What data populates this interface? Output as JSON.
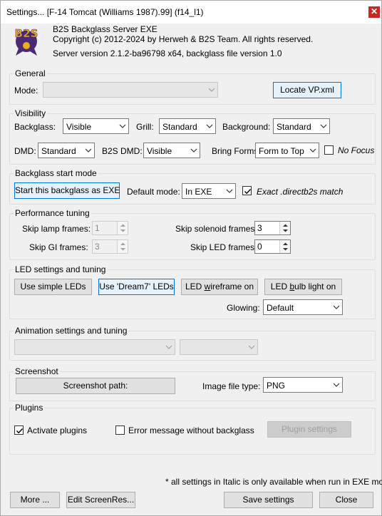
{
  "window": {
    "title": "Settings... [F-14 Tomcat (Williams 1987).99]  (f14_l1)"
  },
  "header": {
    "app_name": "B2S Backglass Server EXE",
    "copyright": "Copyright (c) 2012-2024 by Herweh & B2S Team. All rights reserved.",
    "version": "Server version 2.1.2-ba96798 x64, backglass file version 1.0",
    "logo_text": "B2S"
  },
  "general": {
    "legend": "General",
    "mode_label": "Mode:",
    "mode_value": "",
    "locate_button": "Locate VP.xml"
  },
  "visibility": {
    "legend": "Visibility",
    "backglass_label": "Backglass:",
    "backglass_value": "Visible",
    "grill_label": "Grill:",
    "grill_value": "Standard",
    "background_label": "Background:",
    "background_value": "Standard",
    "dmd_label": "DMD:",
    "dmd_value": "Standard",
    "b2s_dmd_label": "B2S DMD:",
    "b2s_dmd_value": "Visible",
    "bring_forms_label": "Bring Forms",
    "bring_forms_value": "Form to Top",
    "no_focus_label": "No Focus"
  },
  "start_mode": {
    "legend": "Backglass start mode",
    "start_button": "Start this backglass as EXE",
    "default_mode_label": "Default mode:",
    "default_mode_value": "In EXE",
    "exact_match_label": "Exact .directb2s match"
  },
  "performance": {
    "legend": "Performance tuning",
    "skip_lamp_label": "Skip lamp frames:",
    "skip_lamp_value": "1",
    "skip_gi_label": "Skip GI frames:",
    "skip_gi_value": "3",
    "skip_solenoid_label": "Skip solenoid frames:",
    "skip_solenoid_value": "3",
    "skip_led_label": "Skip LED frames:",
    "skip_led_value": "0"
  },
  "led": {
    "legend": "LED settings and tuning",
    "simple_leds_button": "Use simple LEDs",
    "dream7_button": "Use 'Dream7' LEDs",
    "wireframe_pre": "LED ",
    "wireframe_u": "w",
    "wireframe_post": "ireframe on",
    "bulb_pre": "LED ",
    "bulb_u": "b",
    "bulb_post": "ulb light on",
    "glowing_label": "Glowing:",
    "glowing_value": "Default"
  },
  "animation": {
    "legend": "Animation settings and tuning",
    "combo1_value": "",
    "combo2_value": ""
  },
  "screenshot": {
    "legend": "Screenshot",
    "path_button": "Screenshot path:",
    "file_type_label": "Image file type:",
    "file_type_value": "PNG"
  },
  "plugins": {
    "legend": "Plugins",
    "activate_label": "Activate plugins",
    "error_msg_label": "Error message without backglass",
    "settings_button": "Plugin settings"
  },
  "footer": {
    "note": "* all settings in Italic is only available when run in EXE mode!",
    "more_button": "More ...",
    "edit_screenres_button": "Edit ScreenRes...",
    "save_button": "Save settings",
    "close_button": "Close"
  },
  "colors": {
    "accent": "#0078d7",
    "close_red": "#c42b1c",
    "logo_purple": "#4b2a73",
    "logo_gold": "#e8b020"
  }
}
